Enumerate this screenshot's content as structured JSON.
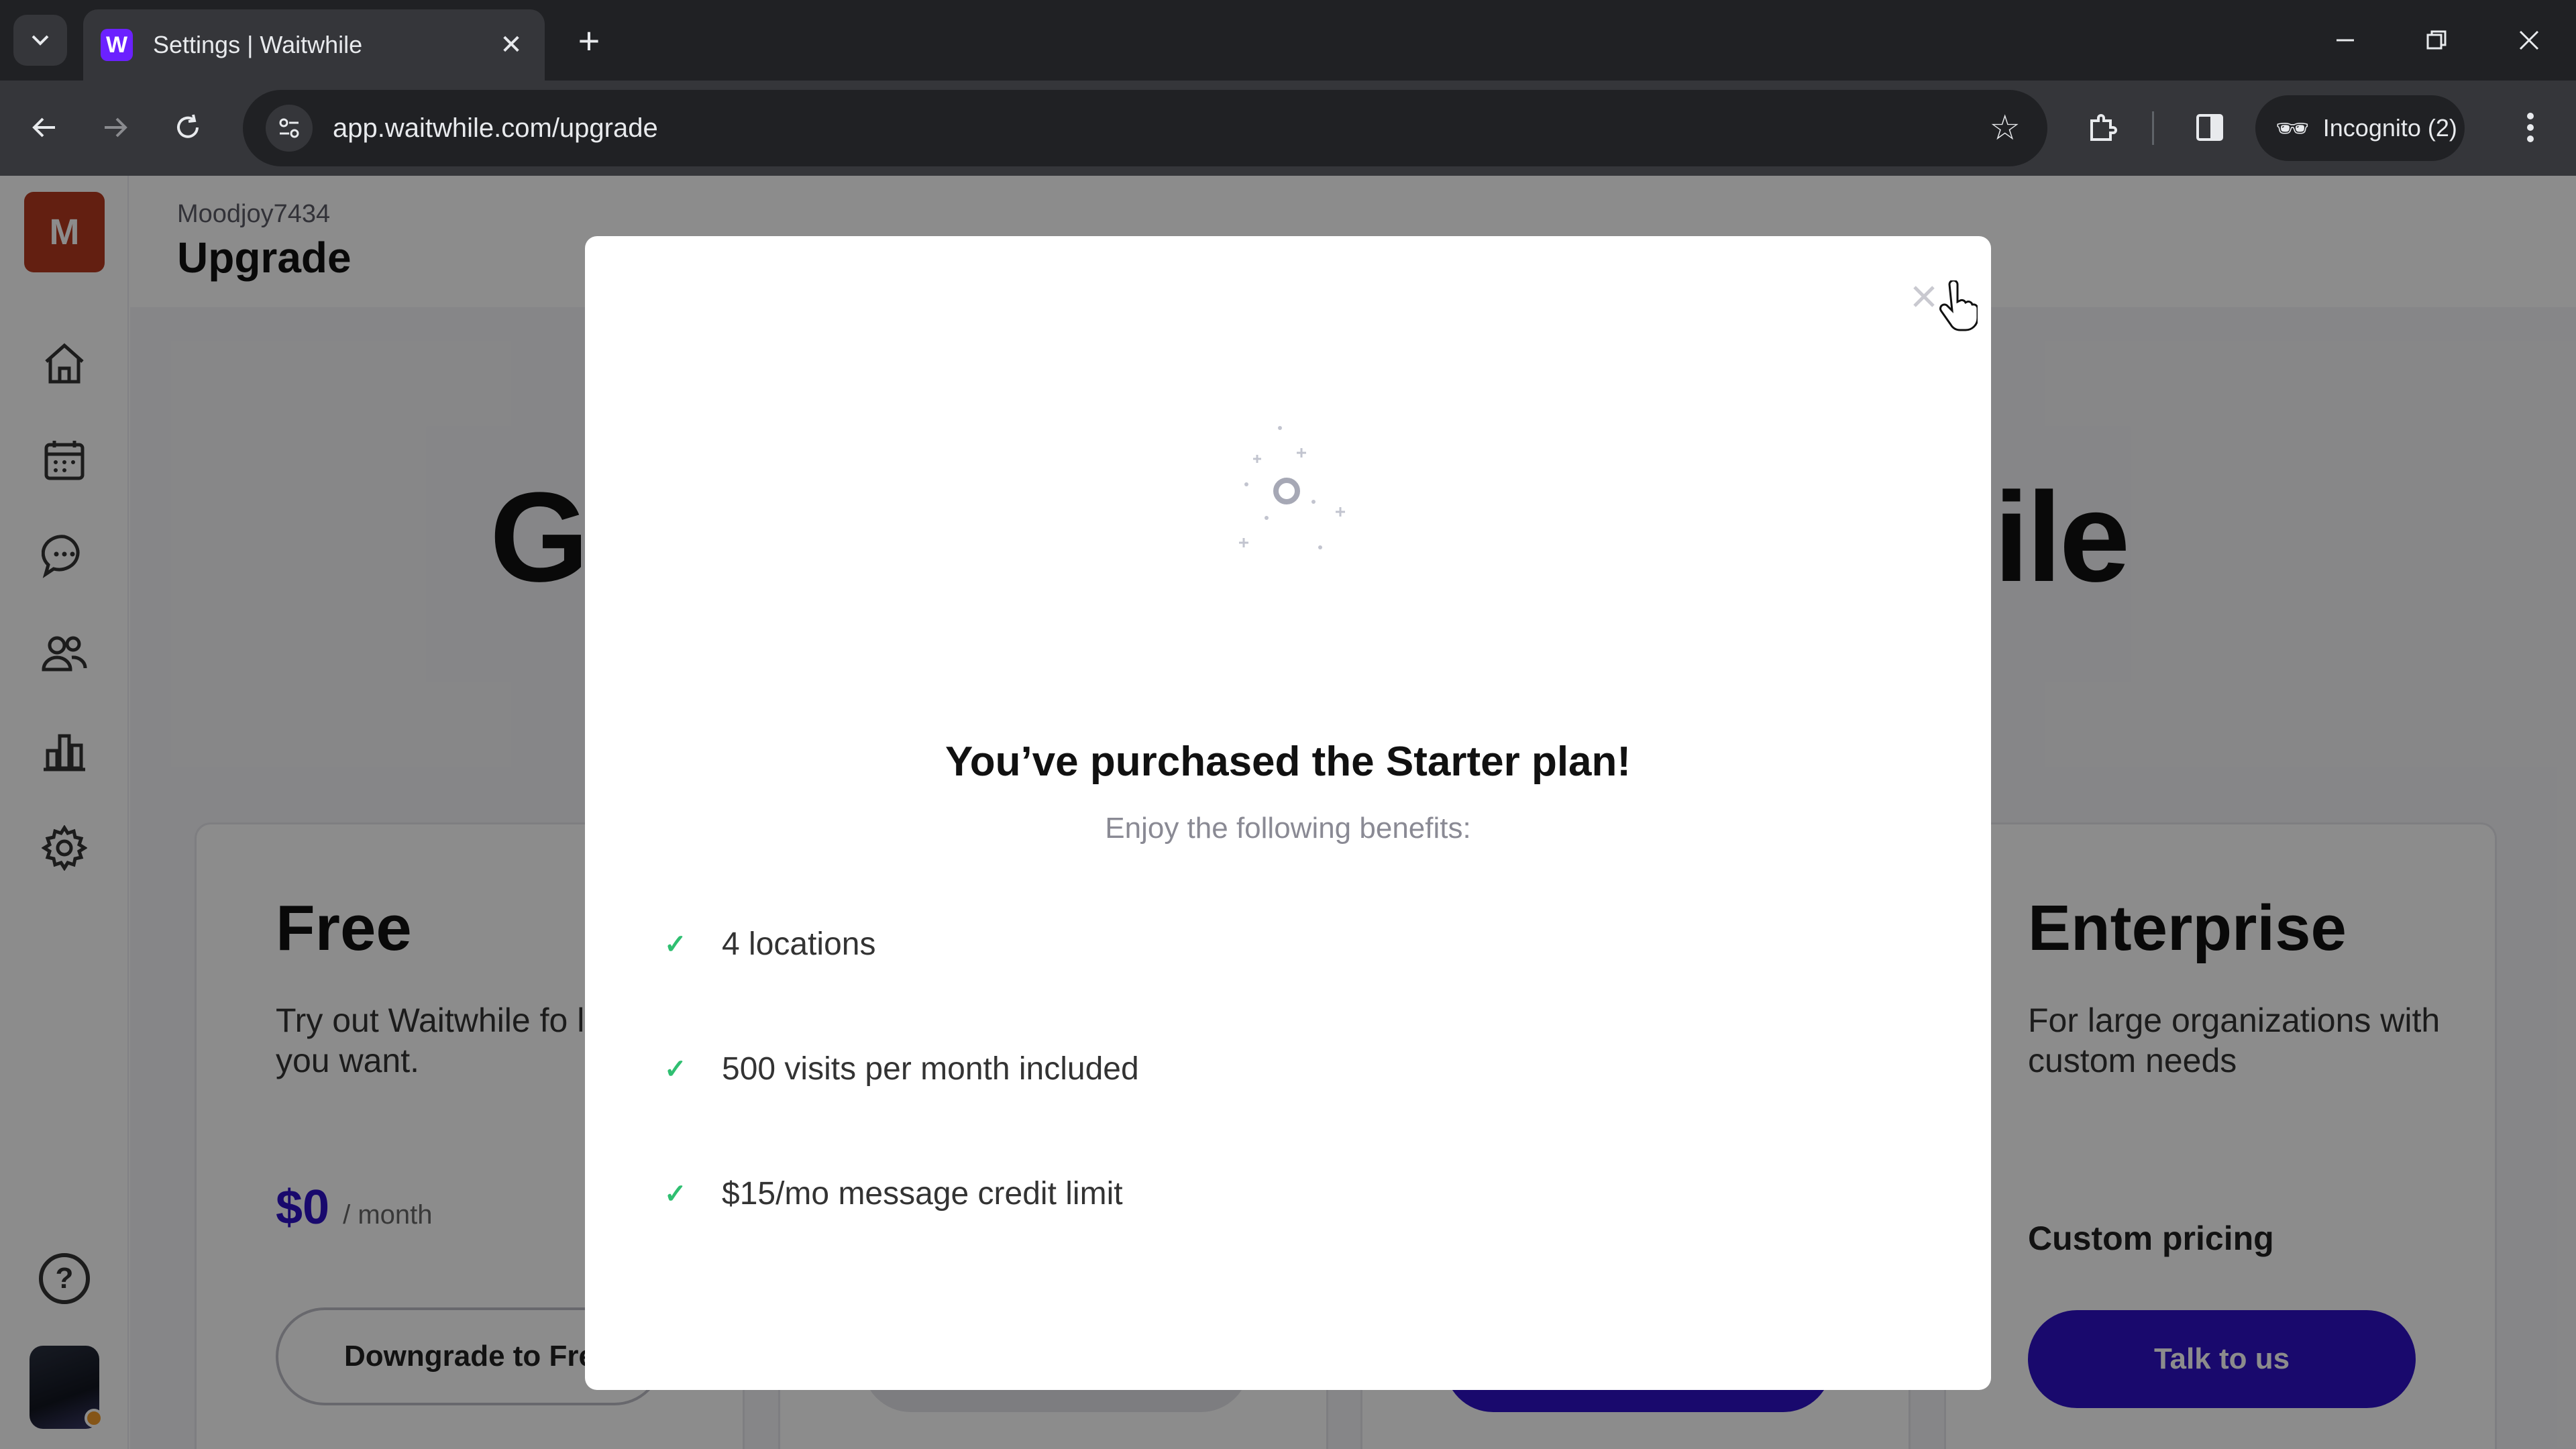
{
  "browser": {
    "tab_title": "Settings | Waitwhile",
    "favicon_letter": "W",
    "url": "app.waitwhile.com/upgrade",
    "incognito_label": "Incognito (2)"
  },
  "app": {
    "avatar_letter": "M",
    "org_name": "Moodjoy7434",
    "page_title": "Upgrade",
    "help_label": "?",
    "headline_left": "G",
    "headline_right": "hile",
    "plans": {
      "free": {
        "name": "Free",
        "description": "Try out Waitwhile fo long as you want.",
        "price": "$0",
        "period": "/ month",
        "button": "Downgrade to Fre"
      },
      "enterprise": {
        "name": "Enterprise",
        "description": "For large organizations with custom needs",
        "pricing": "Custom pricing",
        "button": "Talk to us"
      }
    }
  },
  "modal": {
    "title": "You’ve purchased the Starter plan!",
    "subtitle": "Enjoy the following benefits:",
    "benefits": [
      "4 locations",
      "500 visits per month included",
      "$15/mo message credit limit"
    ]
  },
  "colors": {
    "brand_purple": "#2e12c7",
    "check_green": "#2fbf71",
    "avatar_red": "#b5391f"
  }
}
